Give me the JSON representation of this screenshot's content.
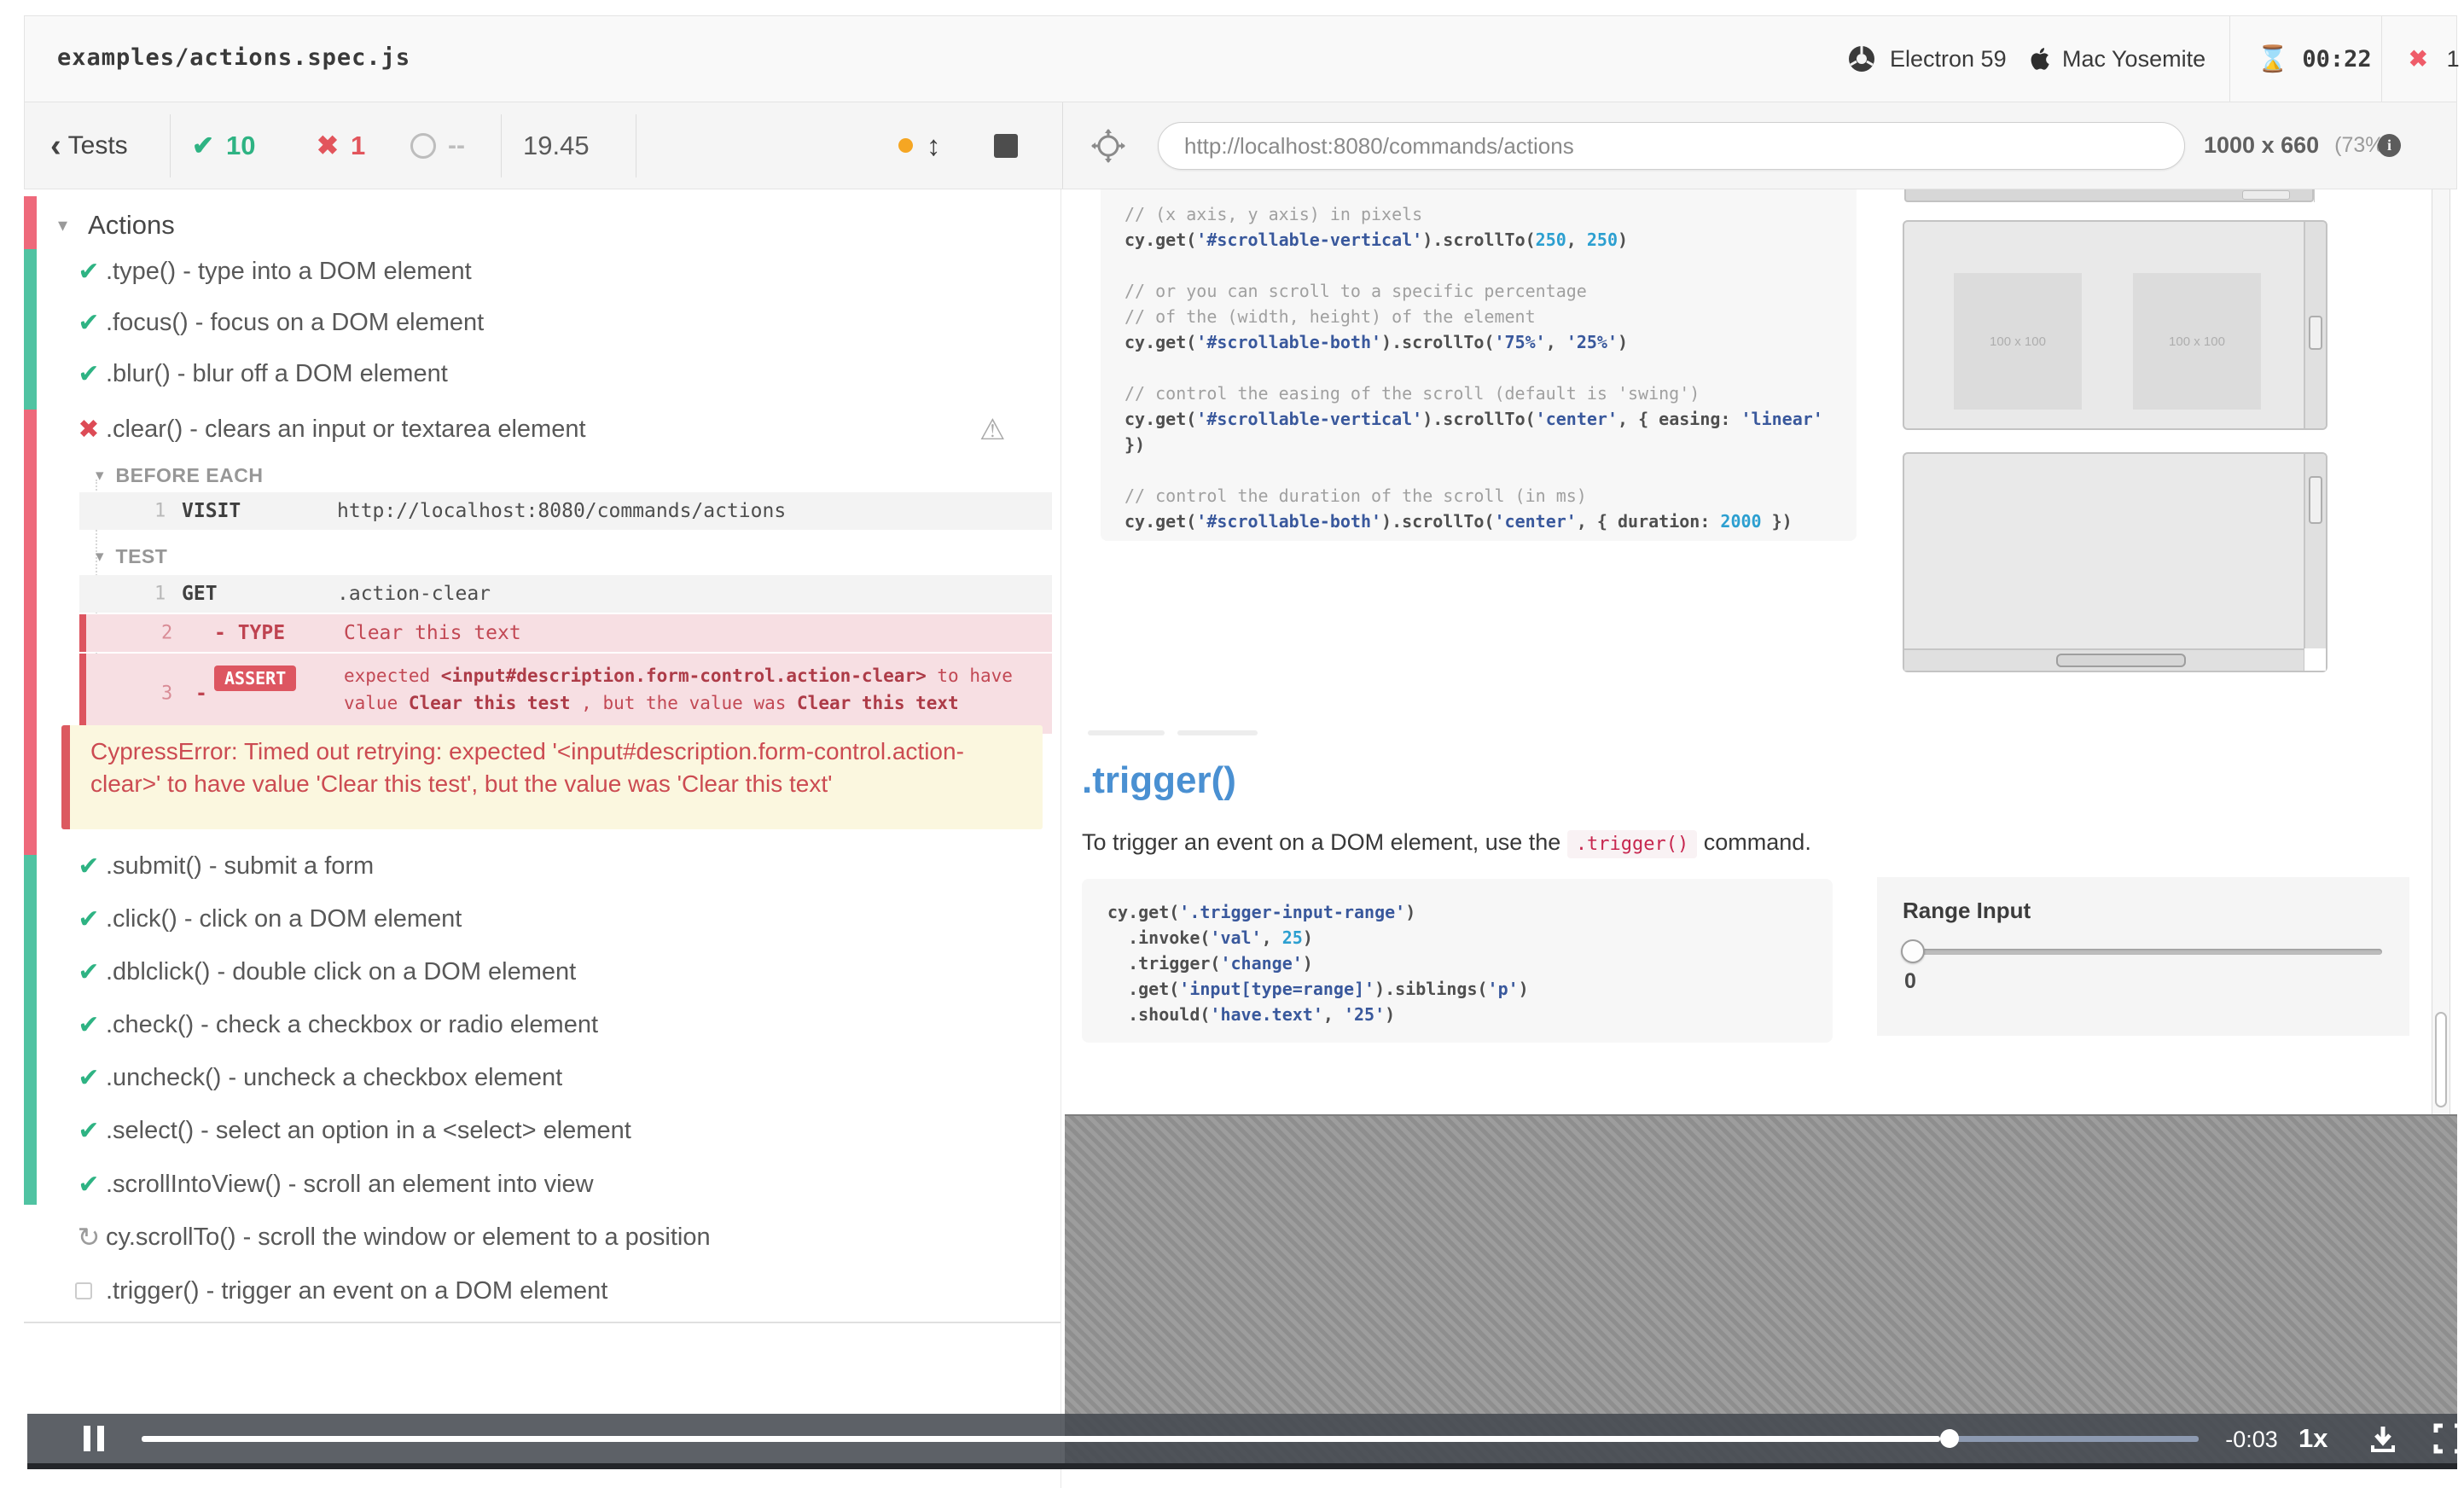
{
  "icons": {
    "caret_down": "▾",
    "check": "✔",
    "cross": "✖",
    "running": "↻",
    "warning": "⚠",
    "chevron_left": "‹",
    "updown_arrow": "↕",
    "hourglass": "⌛",
    "info": "i"
  },
  "header": {
    "spec": "examples/actions.spec.js",
    "browser": "Electron 59",
    "os": "Mac Yosemite",
    "time": "00:22",
    "failures": "1"
  },
  "toolbar": {
    "back": "Tests",
    "passed": "10",
    "failed": "1",
    "pending": "--",
    "duration": "19.45",
    "url": "http://localhost:8080/commands/actions",
    "viewport_size": "1000 x 660",
    "viewport_scale": "(73%)"
  },
  "reporter": {
    "suite_title": "Actions",
    "tests_before": [
      {
        "state": "passed",
        "label": ".type() - type into a DOM element"
      },
      {
        "state": "passed",
        "label": ".focus() - focus on a DOM element"
      },
      {
        "state": "passed",
        "label": ".blur() - blur off a DOM element"
      },
      {
        "state": "failed",
        "label": ".clear() - clears an input or textarea element"
      }
    ],
    "attempt": {
      "before_each_label": "BEFORE EACH",
      "test_label": "TEST",
      "visit": {
        "n": "1",
        "cmd": "VISIT",
        "text": "http://localhost:8080/commands/actions"
      },
      "get": {
        "n": "1",
        "cmd": "GET",
        "text": ".action-clear"
      },
      "type": {
        "n": "2",
        "cmd": "- TYPE",
        "text": "Clear this text"
      },
      "assert": {
        "n": "3",
        "dash": "-",
        "badge": "ASSERT",
        "parts": [
          {
            "t": "expected ",
            "b": false
          },
          {
            "t": "<input#description.form-control.action-clear>",
            "b": true
          },
          {
            "t": " to have value ",
            "b": false
          },
          {
            "t": "Clear this test",
            "b": true
          },
          {
            "t": " , but the value was ",
            "b": false
          },
          {
            "t": "Clear this text",
            "b": true
          }
        ]
      }
    },
    "error_message": "CypressError: Timed out retrying: expected '<input#description.form-control.action-clear>' to have value 'Clear this test', but the value was 'Clear this text'",
    "tests_after": [
      {
        "state": "passed",
        "label": ".submit() - submit a form"
      },
      {
        "state": "passed",
        "label": ".click() - click on a DOM element"
      },
      {
        "state": "passed",
        "label": ".dblclick() - double click on a DOM element"
      },
      {
        "state": "passed",
        "label": ".check() - check a checkbox or radio element"
      },
      {
        "state": "passed",
        "label": ".uncheck() - uncheck a checkbox element"
      },
      {
        "state": "passed",
        "label": ".select() - select an option in a <select> element"
      },
      {
        "state": "passed",
        "label": ".scrollIntoView() - scroll an element into view"
      },
      {
        "state": "running",
        "label": "cy.scrollTo() - scroll the window or element to a position"
      },
      {
        "state": "pending",
        "label": ".trigger() - trigger an event on a DOM element"
      }
    ]
  },
  "aut": {
    "code_block_1": [
      [
        [
          "c",
          "// (x axis, y axis) in pixels"
        ]
      ],
      [
        [
          "k",
          "cy.get("
        ],
        [
          "s",
          "'#scrollable-vertical'"
        ],
        [
          "k",
          ").scrollTo("
        ],
        [
          "n",
          "250"
        ],
        [
          "k",
          ", "
        ],
        [
          "n",
          "250"
        ],
        [
          "k",
          ")"
        ]
      ],
      [],
      [
        [
          "c",
          "// or you can scroll to a specific percentage"
        ]
      ],
      [
        [
          "c",
          "// of the (width, height) of the element"
        ]
      ],
      [
        [
          "k",
          "cy.get("
        ],
        [
          "s",
          "'#scrollable-both'"
        ],
        [
          "k",
          ").scrollTo("
        ],
        [
          "s",
          "'75%'"
        ],
        [
          "k",
          ", "
        ],
        [
          "s",
          "'25%'"
        ],
        [
          "k",
          ")"
        ]
      ],
      [],
      [
        [
          "c",
          "// control the easing of the scroll (default is 'swing')"
        ]
      ],
      [
        [
          "k",
          "cy.get("
        ],
        [
          "s",
          "'#scrollable-vertical'"
        ],
        [
          "k",
          ").scrollTo("
        ],
        [
          "s",
          "'center'"
        ],
        [
          "k",
          ", { easing: "
        ],
        [
          "s",
          "'linear'"
        ]
      ],
      [
        [
          "k",
          "})"
        ]
      ],
      [],
      [
        [
          "c",
          "// control the duration of the scroll (in ms)"
        ]
      ],
      [
        [
          "k",
          "cy.get("
        ],
        [
          "s",
          "'#scrollable-both'"
        ],
        [
          "k",
          ").scrollTo("
        ],
        [
          "s",
          "'center'"
        ],
        [
          "k",
          ", { duration: "
        ],
        [
          "n",
          "2000"
        ],
        [
          "k",
          " })"
        ]
      ]
    ],
    "code_block_2": [
      [
        [
          "k",
          "cy.get("
        ],
        [
          "s",
          "'.trigger-input-range'"
        ],
        [
          "k",
          ")"
        ]
      ],
      [
        [
          "k",
          "  .invoke("
        ],
        [
          "s",
          "'val'"
        ],
        [
          "k",
          ", "
        ],
        [
          "n",
          "25"
        ],
        [
          "k",
          ")"
        ]
      ],
      [
        [
          "k",
          "  .trigger("
        ],
        [
          "s",
          "'change'"
        ],
        [
          "k",
          ")"
        ]
      ],
      [
        [
          "k",
          "  .get("
        ],
        [
          "s",
          "'input[type=range]'"
        ],
        [
          "k",
          ").siblings("
        ],
        [
          "s",
          "'p'"
        ],
        [
          "k",
          ")"
        ]
      ],
      [
        [
          "k",
          "  .should("
        ],
        [
          "s",
          "'have.text'"
        ],
        [
          "k",
          ", "
        ],
        [
          "s",
          "'25'"
        ],
        [
          "k",
          ")"
        ]
      ]
    ],
    "trigger_heading": ".trigger()",
    "trigger_desc_pre": "To trigger an event on a DOM element, use the ",
    "trigger_desc_code": ".trigger()",
    "trigger_desc_post": " command.",
    "box_label": "100 x 100",
    "range_label": "Range Input",
    "range_value": "0"
  },
  "player": {
    "remaining": "-0:03",
    "speed": "1x"
  }
}
